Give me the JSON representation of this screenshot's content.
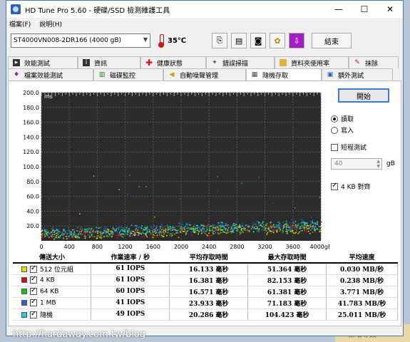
{
  "window": {
    "title": "HD Tune Pro 5.60 - 硬碟/SSD 檢測維護工具"
  },
  "window_controls": {
    "minimize": "—",
    "maximize": "☐",
    "close": "✕"
  },
  "menu": {
    "items": [
      "檔案(F)",
      "說明(H)"
    ]
  },
  "toolbar": {
    "drive": "ST4000VN008-2DR166 (4000 gB)",
    "temperature": "35℃",
    "exit_label": "結束"
  },
  "tabs_top": [
    {
      "label": "效能測試",
      "icon": "performance-icon"
    },
    {
      "label": "資訊",
      "icon": "info-icon"
    },
    {
      "label": "健康狀態",
      "icon": "health-cross-icon"
    },
    {
      "label": "錯誤掃描",
      "icon": "error-scan-icon"
    },
    {
      "label": "資料夾使用率",
      "icon": "folder-icon"
    },
    {
      "label": "抹除",
      "icon": "erase-icon"
    }
  ],
  "tabs_bottom": [
    {
      "label": "檔案效能測試",
      "icon": "file-benchmark-icon"
    },
    {
      "label": "磁碟監控",
      "icon": "disk-monitor-icon"
    },
    {
      "label": "自動噪聲管理",
      "icon": "speaker-icon"
    },
    {
      "label": "隨機存取",
      "icon": "random-access-icon",
      "active": true
    },
    {
      "label": "額外測試",
      "icon": "extra-tests-icon"
    }
  ],
  "controls": {
    "start_label": "開始",
    "read_label": "讀取",
    "write_label": "寫入",
    "short_test_label": "短程測試",
    "short_test_value": "40",
    "short_test_unit": "gB",
    "align_label": "4 KB 對齊"
  },
  "chart_data": {
    "type": "scatter",
    "ylabel": "ms",
    "xlabel": "gB",
    "ylim": [
      0,
      200
    ],
    "xlim": [
      0,
      4000
    ],
    "y_ticks": [
      "200.0",
      "180.0",
      "160.0",
      "140.0",
      "120.0",
      "100.0",
      "80.0",
      "60.0",
      "40.0",
      "20.0"
    ],
    "x_ticks": [
      "0",
      "400",
      "800",
      "1200",
      "1600",
      "2000",
      "2400",
      "2800",
      "3200",
      "3600",
      "4000gB"
    ],
    "grid": true,
    "background": "#2b2b2b",
    "series": [
      {
        "name": "512 位元組",
        "color": "#e8e000",
        "y_start": 10,
        "y_end": 20
      },
      {
        "name": "4 KB",
        "color": "#d01010",
        "y_start": 11,
        "y_end": 21
      },
      {
        "name": "64 KB",
        "color": "#18c018",
        "y_start": 12,
        "y_end": 22
      },
      {
        "name": "1 MB",
        "color": "#2060e0",
        "y_start": 14,
        "y_end": 25
      },
      {
        "name": "隨機",
        "color": "#20d0d0",
        "y_start": 13,
        "y_end": 24
      }
    ]
  },
  "table": {
    "headers": [
      "傳送大小",
      "作業速率 / 秒",
      "平均存取時間",
      "最大存取時間",
      "平均速度"
    ],
    "rows": [
      {
        "label": "512 位元組",
        "color": "#e8e000",
        "rate": "61 IOPS",
        "avg": "16.133 毫秒",
        "max": "51.364 毫秒",
        "speed": "0.030 MB/秒"
      },
      {
        "label": "4 KB",
        "color": "#d01010",
        "rate": "61 IOPS",
        "avg": "16.381 毫秒",
        "max": "82.153 毫秒",
        "speed": "0.238 MB/秒"
      },
      {
        "label": "64 KB",
        "color": "#18c018",
        "rate": "60 IOPS",
        "avg": "16.571 毫秒",
        "max": "61.381 毫秒",
        "speed": "3.771 MB/秒"
      },
      {
        "label": "1 MB",
        "color": "#2060e0",
        "rate": "41 IOPS",
        "avg": "23.933 毫秒",
        "max": "71.183 毫秒",
        "speed": "41.783 MB/秒"
      },
      {
        "label": "隨機",
        "color": "#20d0d0",
        "rate": "49 IOPS",
        "avg": "20.286 毫秒",
        "max": "104.423 毫秒",
        "speed": "25.011 MB/秒"
      }
    ]
  },
  "watermark": "http://hardaway.com.tw/blog",
  "background_note": "新增專案"
}
